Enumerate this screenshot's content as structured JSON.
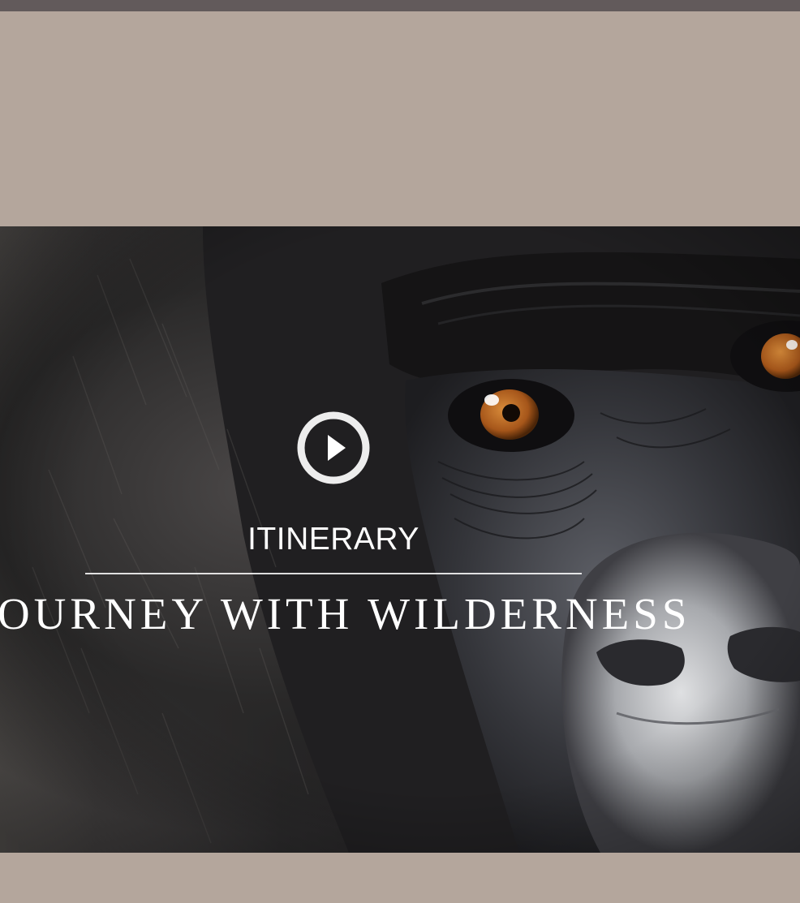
{
  "hero": {
    "eyebrow": "ITINERARY",
    "headline": "JOURNEY WITH WILDERNESS",
    "play_icon": "play-circle-icon",
    "image_subject": "gorilla-closeup"
  },
  "colors": {
    "top_bar": "#625a5b",
    "band": "#b4a69c",
    "text": "#ffffff",
    "eye": "#b8661f"
  }
}
